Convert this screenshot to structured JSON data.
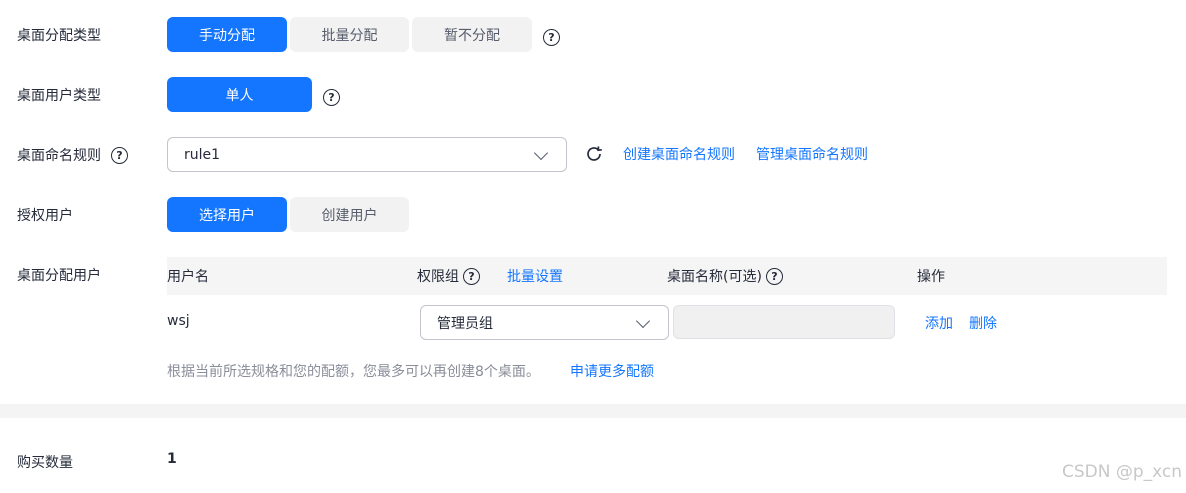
{
  "assign_type": {
    "label": "桌面分配类型",
    "options": [
      "手动分配",
      "批量分配",
      "暂不分配"
    ],
    "selected": 0
  },
  "user_type": {
    "label": "桌面用户类型",
    "options": [
      "单人"
    ],
    "selected": 0
  },
  "naming_rule": {
    "label": "桌面命名规则",
    "value": "rule1",
    "create_link": "创建桌面命名规则",
    "manage_link": "管理桌面命名规则"
  },
  "auth_users": {
    "label": "授权用户",
    "options": [
      "选择用户",
      "创建用户"
    ],
    "selected": 0
  },
  "assign_users": {
    "label": "桌面分配用户",
    "columns": {
      "username": "用户名",
      "permission_group": "权限组",
      "batch_set": "批量设置",
      "desktop_name": "桌面名称(可选)",
      "actions": "操作"
    },
    "rows": [
      {
        "username": "wsj",
        "permission_group": "管理员组",
        "desktop_name": "",
        "add": "添加",
        "delete": "删除"
      }
    ],
    "quota_text": "根据当前所选规格和您的配额，您最多可以再创建8个桌面。",
    "quota_link": "申请更多配额"
  },
  "purchase": {
    "label": "购买数量",
    "value": "1"
  },
  "icons": {
    "help": "question-circle-icon",
    "refresh": "refresh-icon",
    "dropdown": "chevron-down-icon"
  },
  "colors": {
    "primary": "#1476ff",
    "segment_bg": "#f2f2f2",
    "table_header_bg": "#f5f5f5"
  },
  "help_glyph": "?",
  "watermark": "CSDN @p_xcn"
}
